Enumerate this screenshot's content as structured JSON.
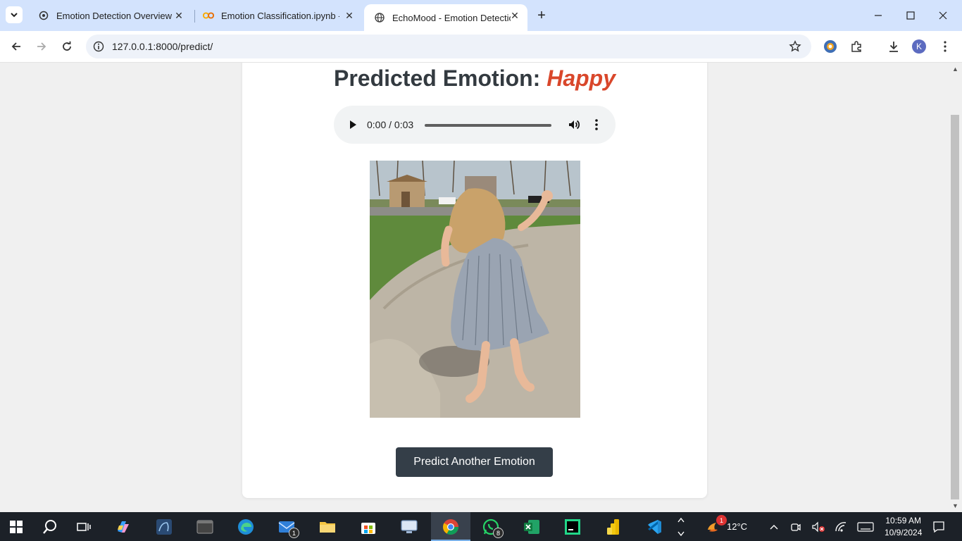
{
  "browser": {
    "tabs": [
      {
        "title": "Emotion Detection Overview",
        "icon": "openai-icon",
        "active": false
      },
      {
        "title": "Emotion Classification.ipynb - C",
        "icon": "colab-icon",
        "active": false
      },
      {
        "title": "EchoMood - Emotion Detection",
        "icon": "globe-icon",
        "active": true
      }
    ],
    "url": "127.0.0.1:8000/predict/",
    "profile_initial": "K"
  },
  "page": {
    "heading_prefix": "Predicted Emotion:",
    "emotion": "Happy",
    "audio": {
      "current": "0:00",
      "duration": "0:03",
      "time_display": "0:00 / 0:03"
    },
    "photo_alt": "Child dancing on sidewalk",
    "button_label": "Predict Another Emotion"
  },
  "taskbar": {
    "mail_badge": "1",
    "whatsapp_badge": "8",
    "weather_badge": "1",
    "temperature": "12°C",
    "time": "10:59 AM",
    "date": "10/9/2024"
  },
  "colors": {
    "emotion": "#d9472b",
    "button": "#343e48",
    "tabbar": "#d3e3fd"
  }
}
